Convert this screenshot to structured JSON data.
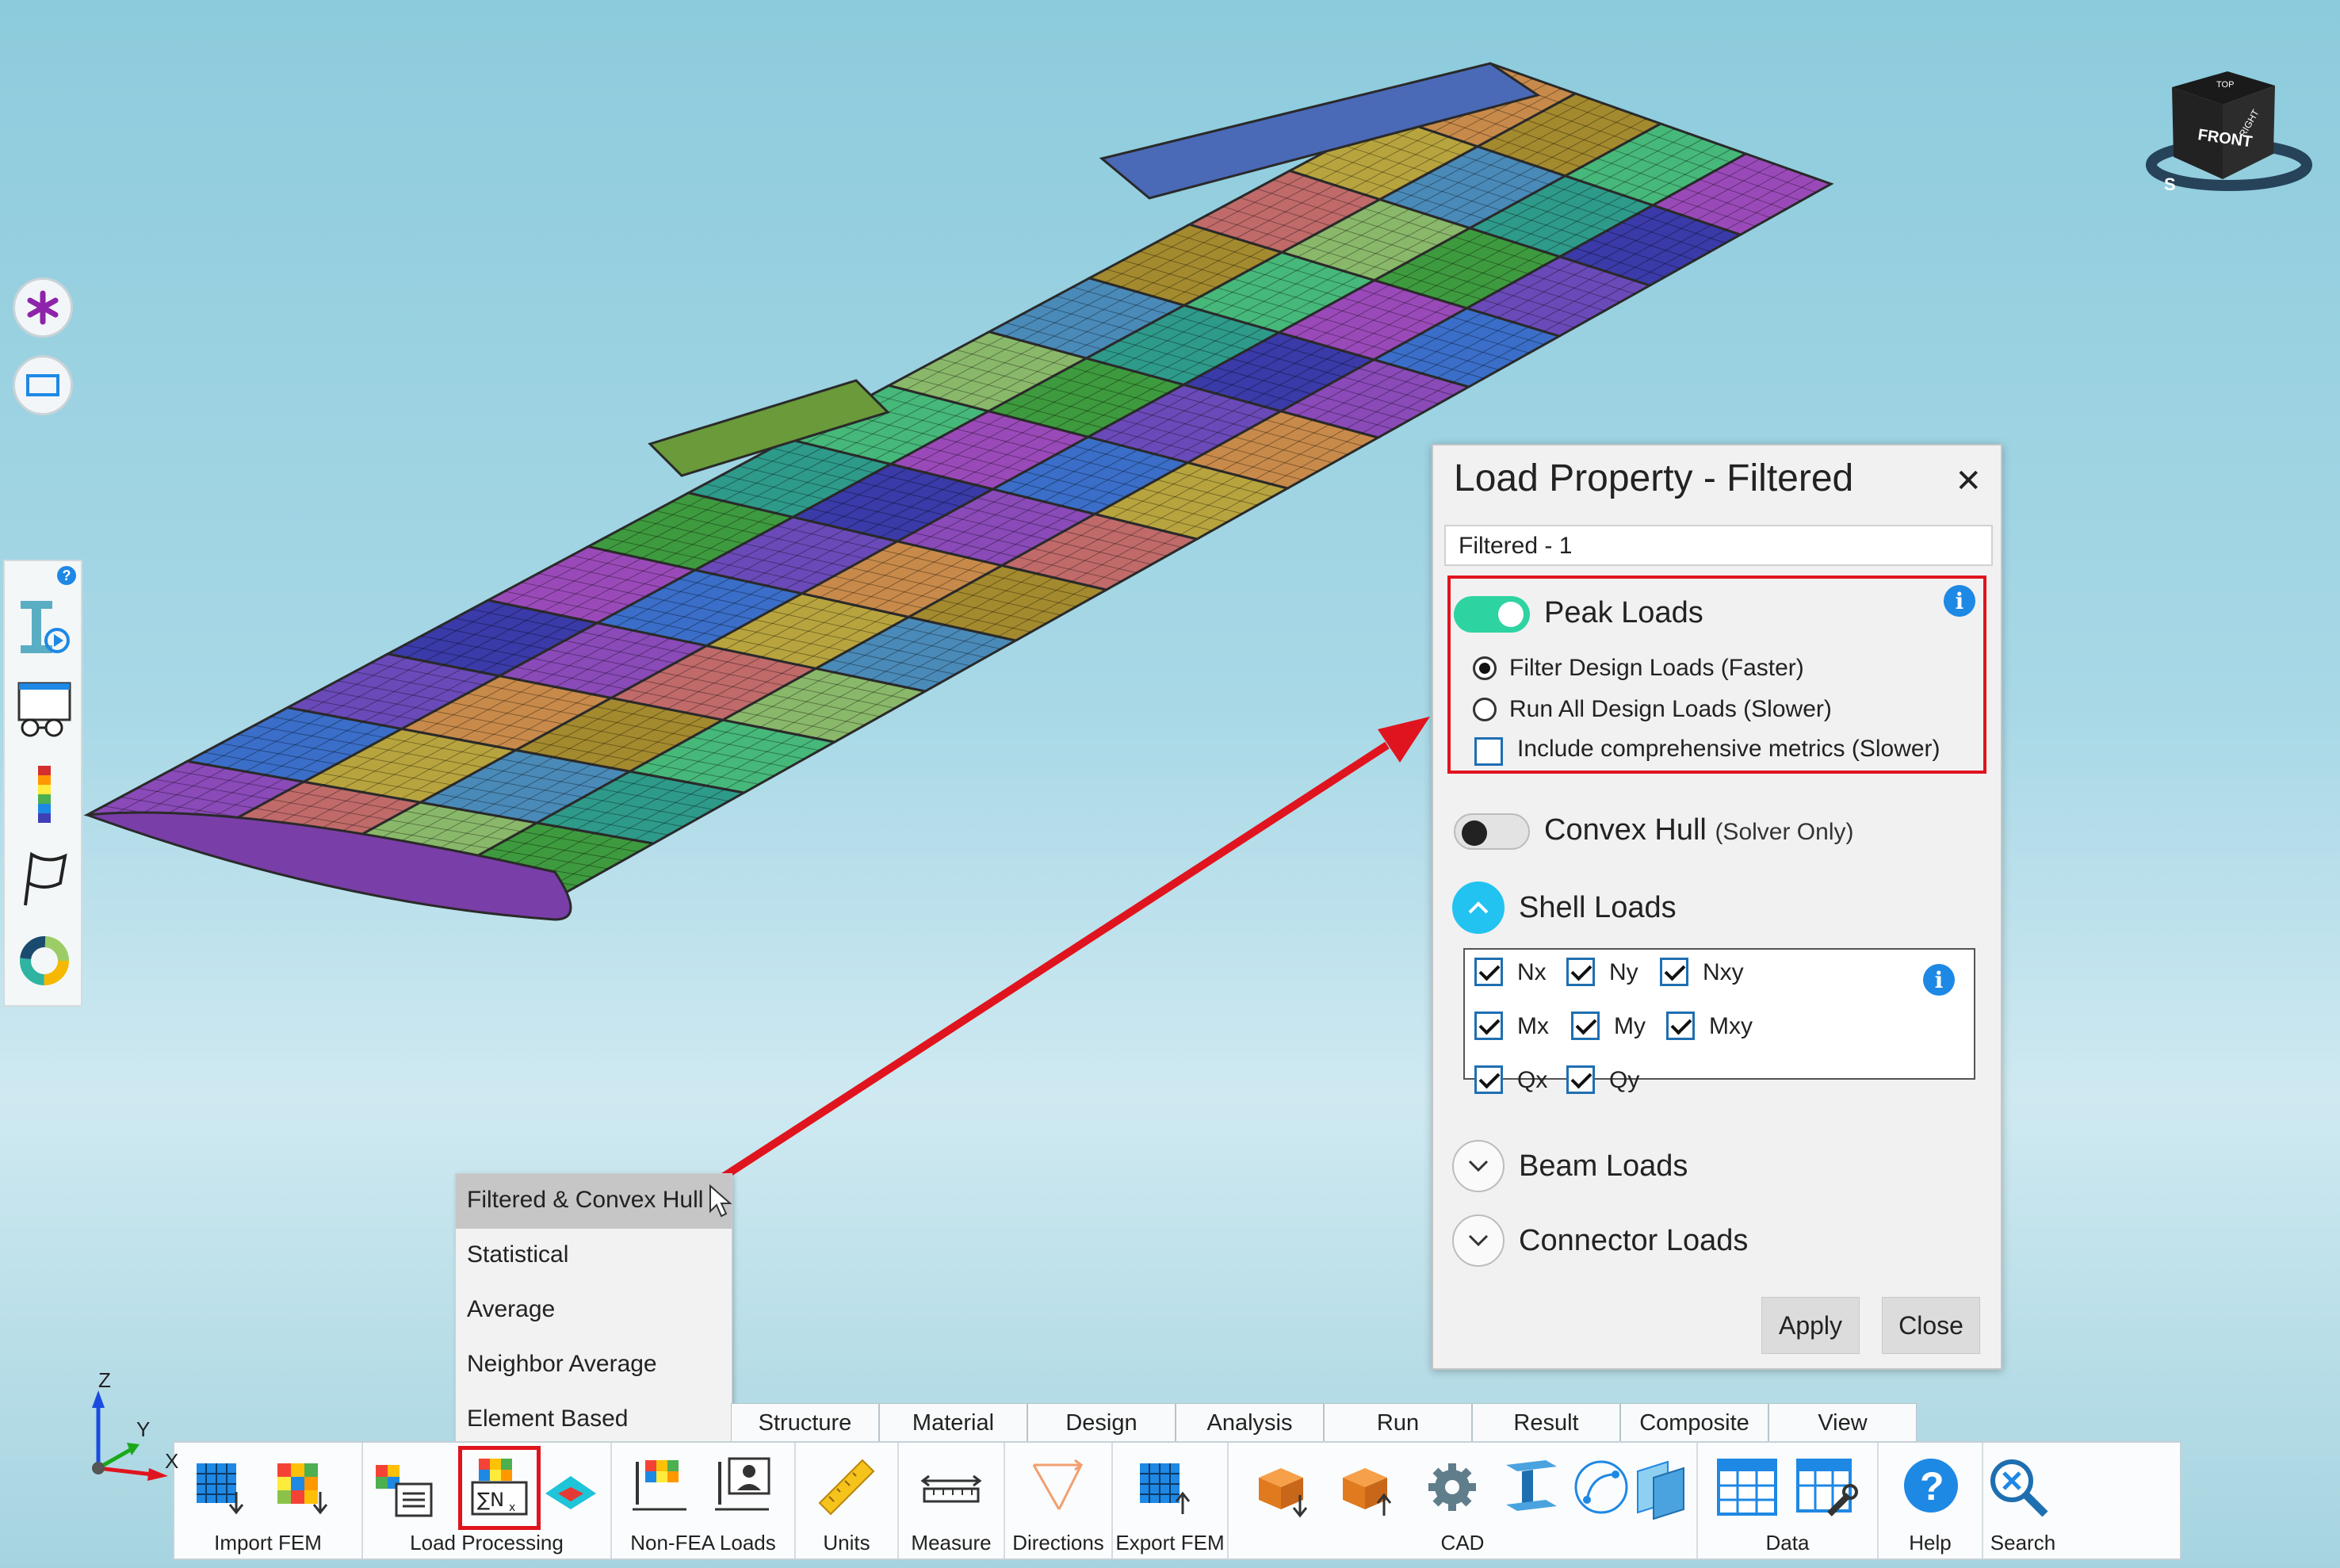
{
  "dialog": {
    "title": "Load Property - Filtered",
    "close_glyph": "✕",
    "name_value": "Filtered - 1",
    "peak_loads": {
      "label": "Peak Loads",
      "enabled": true,
      "options": [
        {
          "label": "Filter Design Loads (Faster)",
          "selected": true
        },
        {
          "label": "Run All Design Loads (Slower)",
          "selected": false
        }
      ],
      "comprehensive_label": "Include comprehensive metrics (Slower)",
      "comprehensive_checked": false
    },
    "convex_hull": {
      "label": "Convex Hull",
      "note": "(Solver Only)",
      "enabled": false
    },
    "shell_loads": {
      "label": "Shell Loads",
      "expanded": true,
      "items": [
        {
          "label": "Nx",
          "checked": true
        },
        {
          "label": "Ny",
          "checked": true
        },
        {
          "label": "Nxy",
          "checked": true
        },
        {
          "label": "Mx",
          "checked": true
        },
        {
          "label": "My",
          "checked": true
        },
        {
          "label": "Mxy",
          "checked": true
        },
        {
          "label": "Qx",
          "checked": true
        },
        {
          "label": "Qy",
          "checked": true
        }
      ]
    },
    "beam_loads": {
      "label": "Beam Loads",
      "expanded": false
    },
    "connector_loads": {
      "label": "Connector Loads",
      "expanded": false
    },
    "apply_label": "Apply",
    "close_label": "Close",
    "info_glyph": "i"
  },
  "context_menu": {
    "items": [
      "Filtered & Convex Hull",
      "Statistical",
      "Average",
      "Neighbor Average",
      "Element Based"
    ],
    "highlighted_index": 0
  },
  "ribbon": {
    "tabs": [
      "Structure",
      "Material",
      "Design",
      "Analysis",
      "Run",
      "Result",
      "Composite",
      "View"
    ],
    "groups": [
      "Import FEM",
      "Load Processing",
      "Non-FEA Loads",
      "Units",
      "Measure",
      "Directions",
      "Export FEM",
      "CAD",
      "Data",
      "Help",
      "Search"
    ]
  },
  "view_cube": {
    "front": "FRONT",
    "right": "RIGHT",
    "top": "TOP",
    "compass_s": "S"
  },
  "axes": {
    "z": "Z",
    "y": "Y",
    "x": "X"
  },
  "left_panel": {
    "help_glyph": "?"
  },
  "side_buttons": [
    "asterisk-icon",
    "rectangle-icon"
  ],
  "colors": {
    "accent_red": "#e0141e",
    "toggle_on": "#2ed3a2",
    "info_blue": "#1e88e5",
    "expander_open": "#22c3f0"
  }
}
